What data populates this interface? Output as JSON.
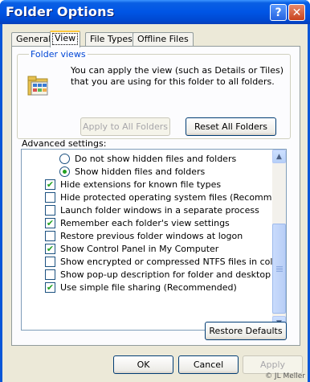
{
  "window": {
    "title": "Folder Options",
    "help_glyph": "?",
    "close_glyph": "✕"
  },
  "tabs": [
    {
      "label": "General",
      "active": false
    },
    {
      "label": "View",
      "active": true
    },
    {
      "label": "File Types",
      "active": false
    },
    {
      "label": "Offline Files",
      "active": false
    }
  ],
  "folder_views": {
    "legend": "Folder views",
    "description": "You can apply the view (such as Details or Tiles) that you are using for this folder to all folders.",
    "apply_all_label": "Apply to All Folders",
    "reset_all_label": "Reset All Folders",
    "icon": "folder-views-icon"
  },
  "advanced": {
    "label": "Advanced settings:",
    "items": [
      {
        "type": "radio",
        "checked": false,
        "label": "Do not show hidden files and folders"
      },
      {
        "type": "radio",
        "checked": true,
        "label": "Show hidden files and folders"
      },
      {
        "type": "checkbox",
        "checked": true,
        "label": "Hide extensions for known file types"
      },
      {
        "type": "checkbox",
        "checked": false,
        "label": "Hide protected operating system files (Recommended)"
      },
      {
        "type": "checkbox",
        "checked": false,
        "label": "Launch folder windows in a separate process"
      },
      {
        "type": "checkbox",
        "checked": true,
        "label": "Remember each folder's view settings"
      },
      {
        "type": "checkbox",
        "checked": false,
        "label": "Restore previous folder windows at logon"
      },
      {
        "type": "checkbox",
        "checked": true,
        "label": "Show Control Panel in My Computer"
      },
      {
        "type": "checkbox",
        "checked": false,
        "label": "Show encrypted or compressed NTFS files in color"
      },
      {
        "type": "checkbox",
        "checked": false,
        "label": "Show pop-up description for folder and desktop items"
      },
      {
        "type": "checkbox",
        "checked": true,
        "label": "Use simple file sharing (Recommended)"
      }
    ],
    "restore_defaults_label": "Restore Defaults"
  },
  "footer": {
    "ok_label": "OK",
    "cancel_label": "Cancel",
    "apply_label": "Apply"
  },
  "watermark": "© JL Meller",
  "colors": {
    "titlebar": "#0055e5",
    "dialog_bg": "#ece9d8",
    "check_green": "#21a121",
    "group_legend": "#0046d5"
  }
}
